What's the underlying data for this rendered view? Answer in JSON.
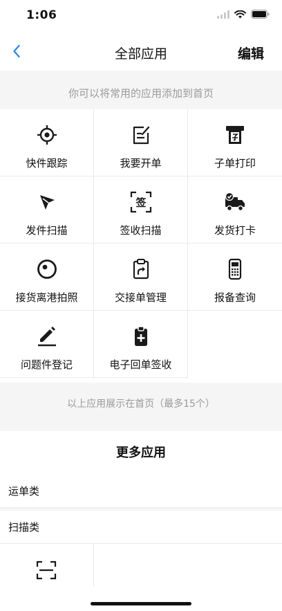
{
  "status_bar": {
    "time": "1:06"
  },
  "nav": {
    "title": "全部应用",
    "edit_label": "编辑"
  },
  "hint_top": "你可以将常用的应用添加到首页",
  "apps": [
    {
      "label": "快件跟踪",
      "icon": "crosshair-icon"
    },
    {
      "label": "我要开单",
      "icon": "edit-order-icon"
    },
    {
      "label": "子单打印",
      "icon": "printer-icon"
    },
    {
      "label": "发件扫描",
      "icon": "cursor-arrow-icon"
    },
    {
      "label": "签收扫描",
      "icon": "sign-scan-icon"
    },
    {
      "label": "发货打卡",
      "icon": "delivery-truck-icon"
    },
    {
      "label": "接货离港拍照",
      "icon": "camera-lens-icon"
    },
    {
      "label": "交接单管理",
      "icon": "clipboard-share-icon"
    },
    {
      "label": "报备查询",
      "icon": "handheld-device-icon"
    },
    {
      "label": "问题件登记",
      "icon": "pen-icon"
    },
    {
      "label": "电子回单签收",
      "icon": "clipboard-plus-icon"
    }
  ],
  "hint_bottom": "以上应用展示在首页（最多15个）",
  "more_apps": {
    "title": "更多应用",
    "categories": [
      {
        "label": "运单类"
      },
      {
        "label": "扫描类"
      }
    ]
  },
  "colors": {
    "accent": "#2f8be6",
    "icon": "#1a1a1a",
    "section_bg": "#f5f5f6",
    "hint_text": "#9a9a9a"
  }
}
